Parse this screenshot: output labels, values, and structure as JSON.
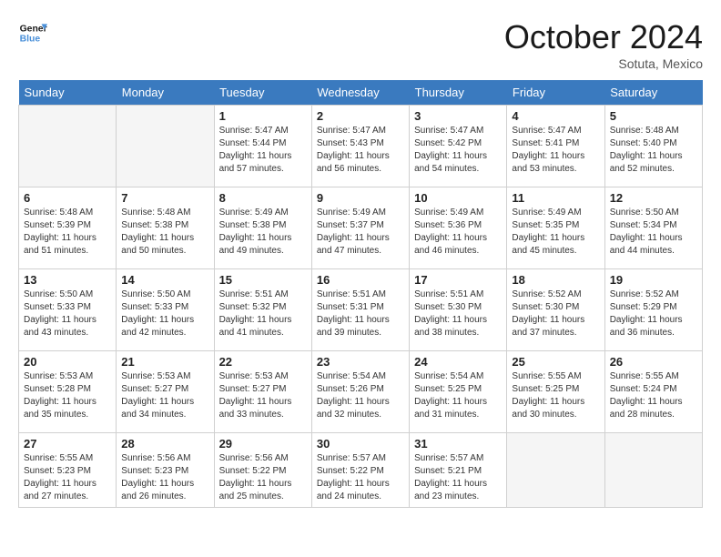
{
  "header": {
    "logo_line1": "General",
    "logo_line2": "Blue",
    "month": "October 2024",
    "location": "Sotuta, Mexico"
  },
  "weekdays": [
    "Sunday",
    "Monday",
    "Tuesday",
    "Wednesday",
    "Thursday",
    "Friday",
    "Saturday"
  ],
  "weeks": [
    [
      {
        "day": "",
        "info": ""
      },
      {
        "day": "",
        "info": ""
      },
      {
        "day": "1",
        "info": "Sunrise: 5:47 AM\nSunset: 5:44 PM\nDaylight: 11 hours and 57 minutes."
      },
      {
        "day": "2",
        "info": "Sunrise: 5:47 AM\nSunset: 5:43 PM\nDaylight: 11 hours and 56 minutes."
      },
      {
        "day": "3",
        "info": "Sunrise: 5:47 AM\nSunset: 5:42 PM\nDaylight: 11 hours and 54 minutes."
      },
      {
        "day": "4",
        "info": "Sunrise: 5:47 AM\nSunset: 5:41 PM\nDaylight: 11 hours and 53 minutes."
      },
      {
        "day": "5",
        "info": "Sunrise: 5:48 AM\nSunset: 5:40 PM\nDaylight: 11 hours and 52 minutes."
      }
    ],
    [
      {
        "day": "6",
        "info": "Sunrise: 5:48 AM\nSunset: 5:39 PM\nDaylight: 11 hours and 51 minutes."
      },
      {
        "day": "7",
        "info": "Sunrise: 5:48 AM\nSunset: 5:38 PM\nDaylight: 11 hours and 50 minutes."
      },
      {
        "day": "8",
        "info": "Sunrise: 5:49 AM\nSunset: 5:38 PM\nDaylight: 11 hours and 49 minutes."
      },
      {
        "day": "9",
        "info": "Sunrise: 5:49 AM\nSunset: 5:37 PM\nDaylight: 11 hours and 47 minutes."
      },
      {
        "day": "10",
        "info": "Sunrise: 5:49 AM\nSunset: 5:36 PM\nDaylight: 11 hours and 46 minutes."
      },
      {
        "day": "11",
        "info": "Sunrise: 5:49 AM\nSunset: 5:35 PM\nDaylight: 11 hours and 45 minutes."
      },
      {
        "day": "12",
        "info": "Sunrise: 5:50 AM\nSunset: 5:34 PM\nDaylight: 11 hours and 44 minutes."
      }
    ],
    [
      {
        "day": "13",
        "info": "Sunrise: 5:50 AM\nSunset: 5:33 PM\nDaylight: 11 hours and 43 minutes."
      },
      {
        "day": "14",
        "info": "Sunrise: 5:50 AM\nSunset: 5:33 PM\nDaylight: 11 hours and 42 minutes."
      },
      {
        "day": "15",
        "info": "Sunrise: 5:51 AM\nSunset: 5:32 PM\nDaylight: 11 hours and 41 minutes."
      },
      {
        "day": "16",
        "info": "Sunrise: 5:51 AM\nSunset: 5:31 PM\nDaylight: 11 hours and 39 minutes."
      },
      {
        "day": "17",
        "info": "Sunrise: 5:51 AM\nSunset: 5:30 PM\nDaylight: 11 hours and 38 minutes."
      },
      {
        "day": "18",
        "info": "Sunrise: 5:52 AM\nSunset: 5:30 PM\nDaylight: 11 hours and 37 minutes."
      },
      {
        "day": "19",
        "info": "Sunrise: 5:52 AM\nSunset: 5:29 PM\nDaylight: 11 hours and 36 minutes."
      }
    ],
    [
      {
        "day": "20",
        "info": "Sunrise: 5:53 AM\nSunset: 5:28 PM\nDaylight: 11 hours and 35 minutes."
      },
      {
        "day": "21",
        "info": "Sunrise: 5:53 AM\nSunset: 5:27 PM\nDaylight: 11 hours and 34 minutes."
      },
      {
        "day": "22",
        "info": "Sunrise: 5:53 AM\nSunset: 5:27 PM\nDaylight: 11 hours and 33 minutes."
      },
      {
        "day": "23",
        "info": "Sunrise: 5:54 AM\nSunset: 5:26 PM\nDaylight: 11 hours and 32 minutes."
      },
      {
        "day": "24",
        "info": "Sunrise: 5:54 AM\nSunset: 5:25 PM\nDaylight: 11 hours and 31 minutes."
      },
      {
        "day": "25",
        "info": "Sunrise: 5:55 AM\nSunset: 5:25 PM\nDaylight: 11 hours and 30 minutes."
      },
      {
        "day": "26",
        "info": "Sunrise: 5:55 AM\nSunset: 5:24 PM\nDaylight: 11 hours and 28 minutes."
      }
    ],
    [
      {
        "day": "27",
        "info": "Sunrise: 5:55 AM\nSunset: 5:23 PM\nDaylight: 11 hours and 27 minutes."
      },
      {
        "day": "28",
        "info": "Sunrise: 5:56 AM\nSunset: 5:23 PM\nDaylight: 11 hours and 26 minutes."
      },
      {
        "day": "29",
        "info": "Sunrise: 5:56 AM\nSunset: 5:22 PM\nDaylight: 11 hours and 25 minutes."
      },
      {
        "day": "30",
        "info": "Sunrise: 5:57 AM\nSunset: 5:22 PM\nDaylight: 11 hours and 24 minutes."
      },
      {
        "day": "31",
        "info": "Sunrise: 5:57 AM\nSunset: 5:21 PM\nDaylight: 11 hours and 23 minutes."
      },
      {
        "day": "",
        "info": ""
      },
      {
        "day": "",
        "info": ""
      }
    ]
  ]
}
